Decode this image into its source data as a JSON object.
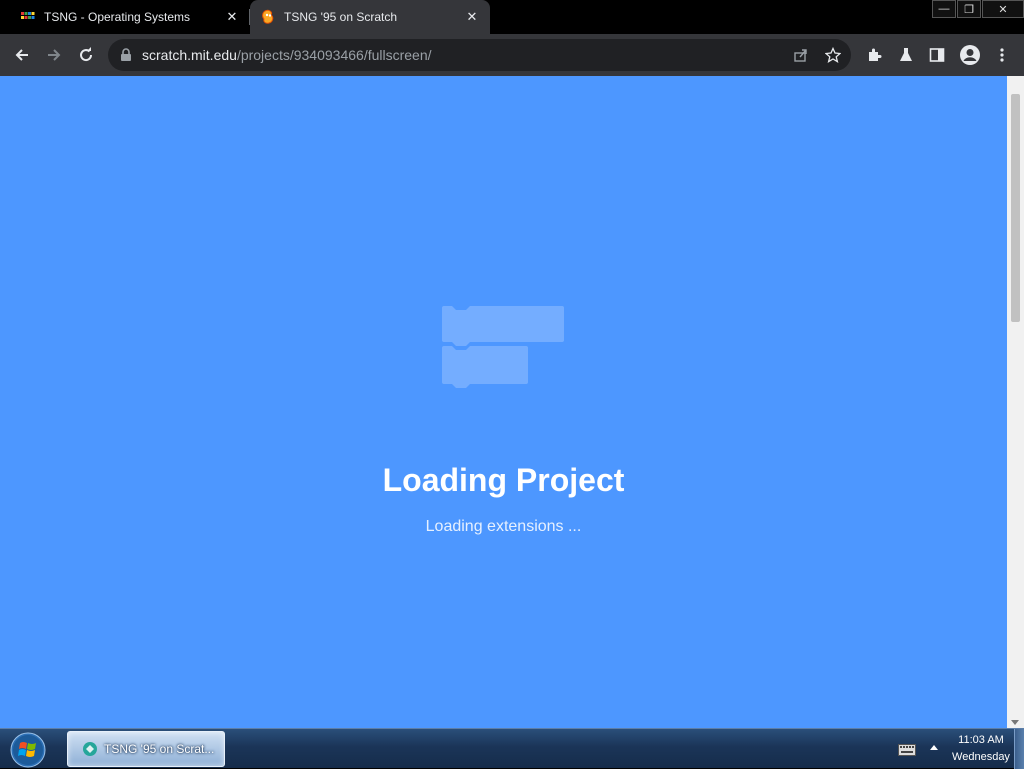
{
  "tabs": [
    {
      "title": "TSNG - Operating Systems",
      "close": "✕"
    },
    {
      "title": "TSNG '95 on Scratch",
      "close": "✕"
    }
  ],
  "window_controls": {
    "minimize": "—",
    "restore": "❐",
    "close": "✕"
  },
  "omnibox": {
    "host": "scratch.mit.edu",
    "path": "/projects/934093466/fullscreen/"
  },
  "loader": {
    "title": "Loading Project",
    "subtitle": "Loading extensions ..."
  },
  "taskbar": {
    "task_label": "TSNG '95 on Scrat...",
    "clock_time": "11:03 AM",
    "clock_day": "Wednesday"
  },
  "colors": {
    "stage_background": "#4d97ff",
    "browser_frame": "#35363a"
  },
  "icons": [
    "back-icon",
    "forward-icon",
    "reload-icon",
    "lock-icon",
    "share-icon",
    "star-icon",
    "extensions-icon",
    "labs-icon",
    "side-panel-icon",
    "profile-icon",
    "menu-icon",
    "windows-start-icon"
  ]
}
